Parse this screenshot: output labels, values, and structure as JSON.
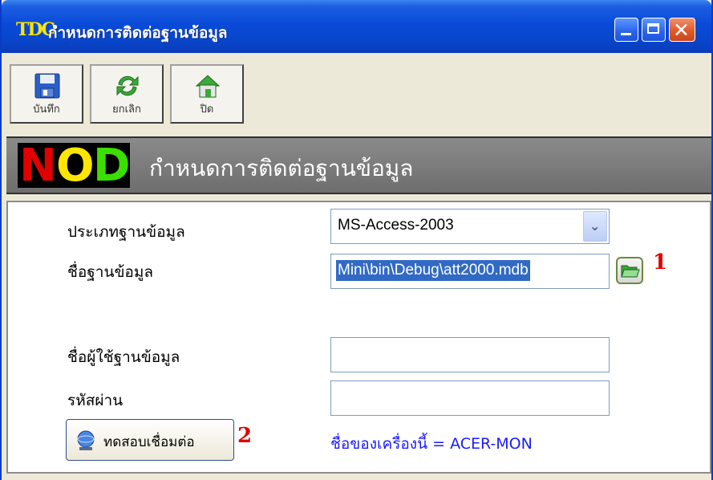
{
  "window": {
    "logo_text": "TDC",
    "title": "กำหนดการติดต่อฐานข้อมูล",
    "controls": {
      "minimize": "minimize-icon",
      "maximize": "maximize-icon",
      "close": "close-icon"
    }
  },
  "toolbar": {
    "buttons": [
      {
        "label": "บันทึก",
        "icon": "save-disk-icon"
      },
      {
        "label": "ยกเลิก",
        "icon": "refresh-arrows-icon"
      },
      {
        "label": "ปิด",
        "icon": "home-icon"
      }
    ]
  },
  "banner": {
    "logo_text": "NOD",
    "title": "กำหนดการติดต่อฐานข้อมูล",
    "colors": {
      "N": "#e00000",
      "O": "#ffe600",
      "D": "#3adf00"
    }
  },
  "form": {
    "db_type_label": "ประเภทฐานข้อมูล",
    "db_type_value": "MS-Access-2003",
    "db_name_label": "ชื่อฐานข้อมูล",
    "db_name_value": "Mini\\bin\\Debug\\att2000.mdb",
    "db_user_label": "ชื่อผู้ใช้ฐานข้อมูล",
    "db_user_value": "",
    "password_label": "รหัสผ่าน",
    "password_value": "",
    "browse_icon": "folder-open-icon",
    "marker_1": "1",
    "marker_2": "2",
    "test_button_label": "ทดสอบเชื่อมต่อ",
    "test_button_icon": "network-globe-icon",
    "machine_name": "ชื่อของเครื่องนี้ = ACER-MON"
  }
}
